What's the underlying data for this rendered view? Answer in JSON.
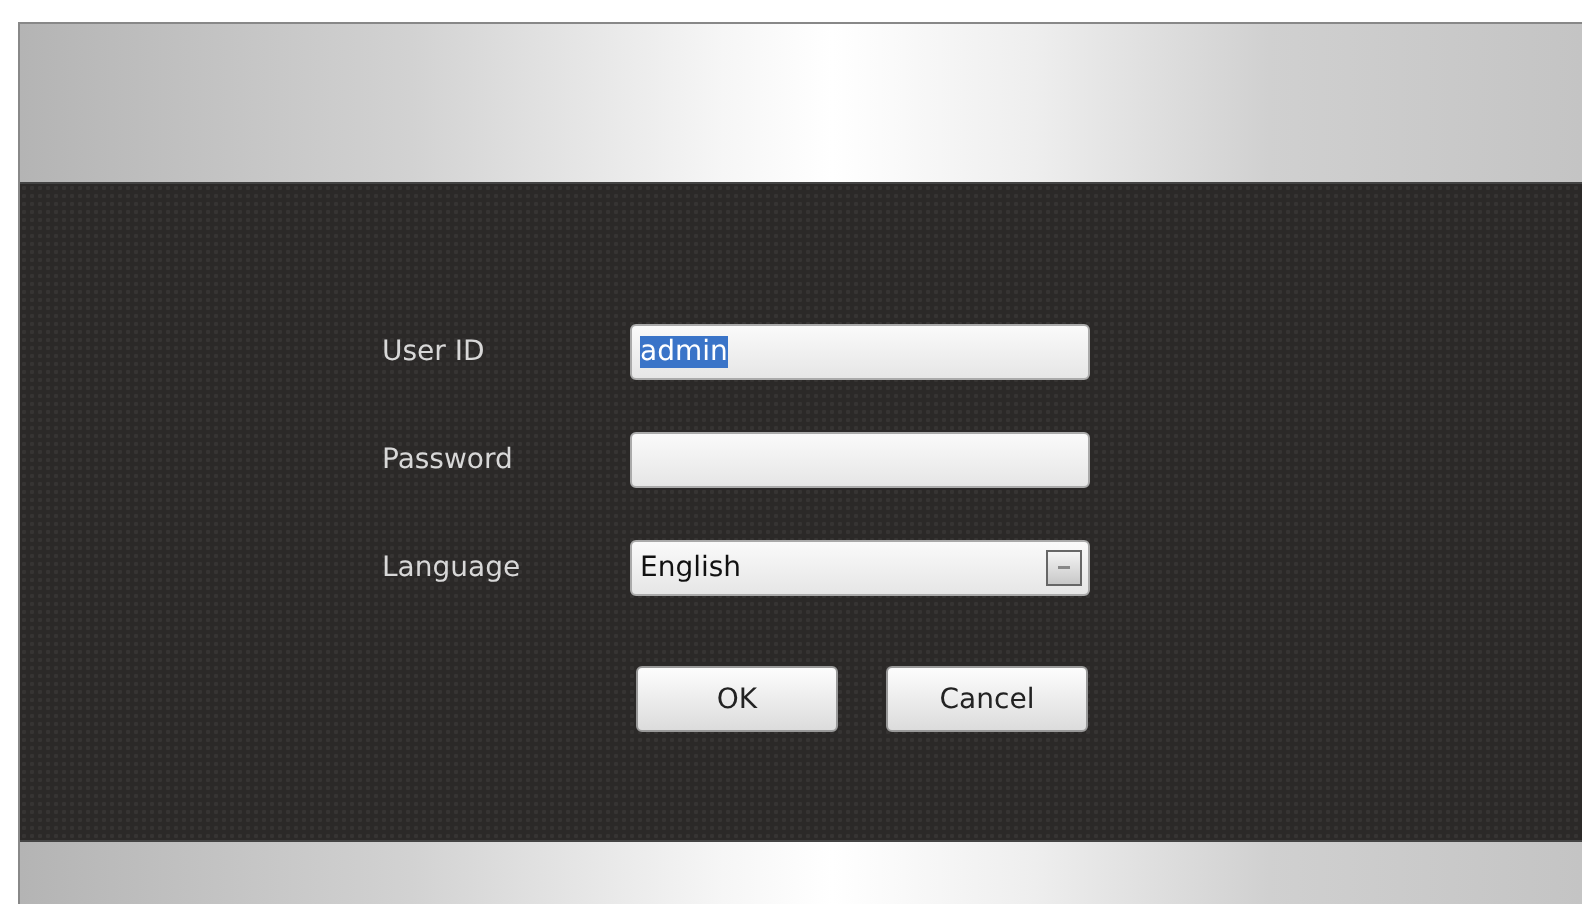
{
  "login_form": {
    "fields": [
      {
        "kind": "text",
        "label": "User ID",
        "value": "admin",
        "text_selected": true
      },
      {
        "kind": "password",
        "label": "Password"
      },
      {
        "kind": "dropdown",
        "label": "Language",
        "value": "English"
      }
    ],
    "buttons": [
      "OK",
      "Cancel"
    ]
  }
}
